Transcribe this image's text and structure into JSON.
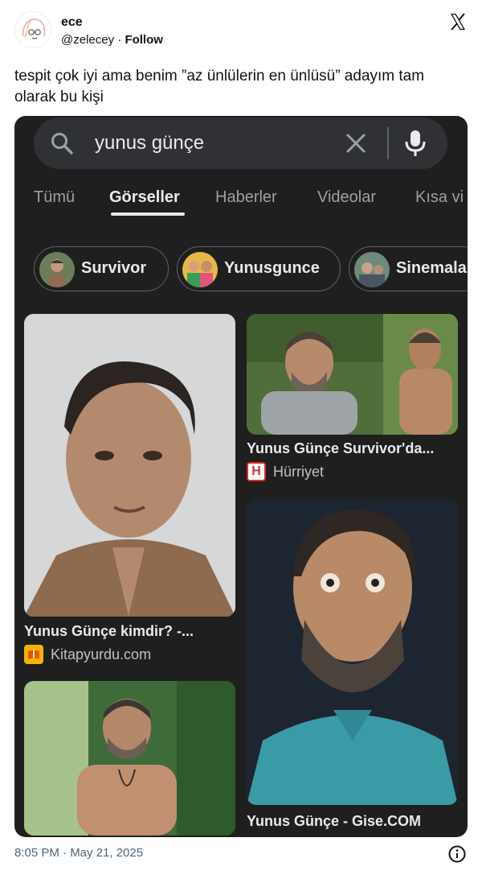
{
  "tweet": {
    "author_name": "ece",
    "handle": "@zelecey",
    "separator": "·",
    "follow_label": "Follow",
    "text": "tespit çok iyi ama benim ”az ünlülerin en ünlüsü” adayım tam olarak bu kişi",
    "timestamp": "8:05 PM · May 21, 2025",
    "icons": {
      "logo": "x-logo-icon",
      "info": "info-icon",
      "avatar": "line-art-avatar"
    }
  },
  "google": {
    "search": {
      "query": "yunus günçe",
      "icons": [
        "search-icon",
        "clear-icon",
        "mic-icon"
      ]
    },
    "tabs": [
      {
        "label": "Tümü"
      },
      {
        "label": "Görseller",
        "active": true
      },
      {
        "label": "Haberler"
      },
      {
        "label": "Videolar"
      },
      {
        "label": "Kısa vi"
      }
    ],
    "chips": [
      {
        "label": "Survivor"
      },
      {
        "label": "Yunusgunce"
      },
      {
        "label": "Sinemala"
      }
    ],
    "results": [
      {
        "title": "Yunus Günçe Survivor'da...",
        "source": "Hürriyet",
        "favicon_letter": "H",
        "favicon_color": "#d32f2f"
      },
      {
        "title": "Yunus Günçe kimdir? -...",
        "source": "Kitapyurdu.com",
        "favicon_color": "#f5b400"
      },
      {
        "title": "Yunus Günçe - Gise.COM"
      }
    ]
  },
  "colors": {
    "screenshot_bg": "#1f1f1f",
    "search_bg": "#303134",
    "text_primary": "#e8eaed",
    "text_secondary": "#9aa0a6"
  }
}
